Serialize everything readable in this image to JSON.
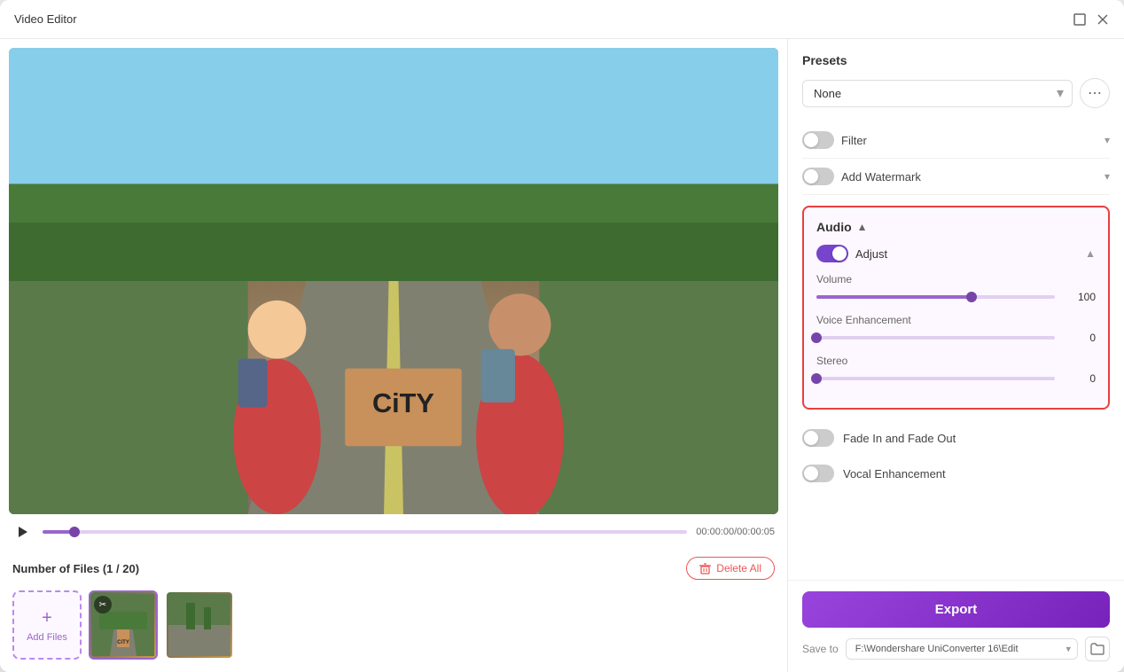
{
  "window": {
    "title": "Video Editor"
  },
  "video_controls": {
    "time": "00:00:00/00:00:05"
  },
  "file_section": {
    "label": "Number of Files (1 / 20)",
    "delete_all": "Delete All",
    "add_files": "Add Files"
  },
  "right_panel": {
    "presets_title": "Presets",
    "presets_value": "None",
    "filter_label": "Filter",
    "watermark_label": "Add Watermark",
    "audio_title": "Audio",
    "adjust_label": "Adjust",
    "volume_label": "Volume",
    "volume_value": "100",
    "volume_pct": 65,
    "voice_enhancement_label": "Voice Enhancement",
    "voice_enhancement_value": "0",
    "voice_enhancement_pct": 0,
    "stereo_label": "Stereo",
    "stereo_value": "0",
    "stereo_pct": 0,
    "fade_in_out_label": "Fade In and Fade Out",
    "vocal_enhancement_label": "Vocal Enhancement",
    "export_btn": "Export",
    "save_to_label": "Save to",
    "save_path": "F:\\Wondershare UniConverter 16\\Edit"
  }
}
